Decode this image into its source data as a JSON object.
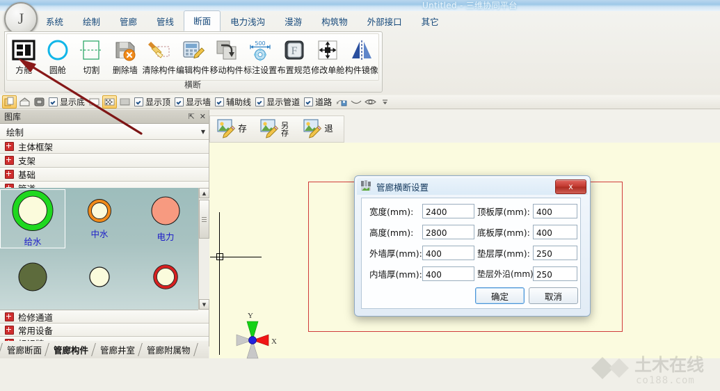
{
  "window": {
    "title": "Untitled - 三维协同平台",
    "app_badge": "J"
  },
  "ribbon": {
    "tabs": [
      {
        "label": "系统",
        "active": false
      },
      {
        "label": "绘制",
        "active": false
      },
      {
        "label": "管廊",
        "active": false
      },
      {
        "label": "管线",
        "active": false
      },
      {
        "label": "断面",
        "active": true
      },
      {
        "label": "电力浅沟",
        "active": false
      },
      {
        "label": "漫游",
        "active": false
      },
      {
        "label": "构筑物",
        "active": false
      },
      {
        "label": "外部接口",
        "active": false
      },
      {
        "label": "其它",
        "active": false
      }
    ],
    "group_label": "横断",
    "buttons": [
      {
        "label": "方舱",
        "icon": "box-cabin-icon"
      },
      {
        "label": "圆舱",
        "icon": "circle-cabin-icon"
      },
      {
        "label": "切割",
        "icon": "cut-icon"
      },
      {
        "label": "删除墙",
        "icon": "delete-wall-icon"
      },
      {
        "label": "清除构件",
        "icon": "clear-component-icon"
      },
      {
        "label": "编辑构件",
        "icon": "edit-component-icon"
      },
      {
        "label": "移动构件",
        "icon": "move-component-icon"
      },
      {
        "label": "标注设置",
        "icon": "dimension-settings-icon"
      },
      {
        "label": "布置规范",
        "icon": "layout-spec-icon"
      },
      {
        "label": "修改单舱",
        "icon": "modify-cabin-icon"
      },
      {
        "label": "构件镜像",
        "icon": "mirror-component-icon"
      }
    ]
  },
  "viewbar": {
    "icons": [
      "copy-layer-icon",
      "house-icon",
      "solid-view-icon"
    ],
    "icons2": [
      "blank-fill-icon",
      "checker-fill-icon",
      "hatch-fill-icon"
    ],
    "icons3": [
      "save-view-icon",
      "curve-icon",
      "eye-icon",
      "more-icon"
    ],
    "checks": [
      {
        "label": "显示底",
        "checked": true
      },
      {
        "label": "显示顶",
        "checked": true
      },
      {
        "label": "显示墙",
        "checked": true
      },
      {
        "label": "辅助线",
        "checked": true
      },
      {
        "label": "显示管道",
        "checked": true
      },
      {
        "label": "道路",
        "checked": true
      }
    ]
  },
  "library": {
    "title": "图库",
    "pin_icon": "pin-icon",
    "close_icon": "close-icon",
    "category": "绘制",
    "items_top": [
      {
        "label": "主体框架"
      },
      {
        "label": "支架"
      },
      {
        "label": "基础"
      },
      {
        "label": "管道"
      }
    ],
    "thumbnails": [
      {
        "label": "给水",
        "style": "ring",
        "ring": "#1fd81f",
        "fill": "#fbfbdc",
        "selected": true
      },
      {
        "label": "中水",
        "style": "ring",
        "ring": "#f08a1a",
        "fill": "#fbfbdc",
        "selected": false
      },
      {
        "label": "电力",
        "style": "solid",
        "ring": "#1a1a1a",
        "fill": "#f79a80",
        "selected": false
      },
      {
        "label": "",
        "style": "solid",
        "ring": "#1a1a1a",
        "fill": "#5d6b3c",
        "selected": false
      },
      {
        "label": "",
        "style": "ring",
        "ring": "#1a1a1a",
        "fill": "#fbfbdc",
        "selected": false
      },
      {
        "label": "",
        "style": "ring",
        "ring": "#d81f1f",
        "fill": "#fbfbdc",
        "selected": false
      }
    ],
    "items_bottom": [
      {
        "label": "检修通道"
      },
      {
        "label": "常用设备"
      },
      {
        "label": "标识牌"
      }
    ],
    "bottom_tabs": [
      {
        "label": "管廊断面",
        "active": false
      },
      {
        "label": "管廊构件",
        "active": true
      },
      {
        "label": "管廊井室",
        "active": false
      },
      {
        "label": "管廊附属物",
        "active": false
      }
    ]
  },
  "canvas": {
    "save_buttons": [
      {
        "label": "存",
        "icon": "save-image-icon"
      },
      {
        "label": "另存",
        "icon": "save-as-image-icon"
      },
      {
        "label": "退",
        "icon": "exit-image-icon"
      }
    ],
    "axis": {
      "x": "X",
      "y": "Y"
    },
    "watermark": {
      "text": "土木在线",
      "sub": "co188.com"
    }
  },
  "dialog": {
    "title": "管廊横断设置",
    "icon": "dialog-icon",
    "close_label": "x",
    "fields_left": [
      {
        "label": "宽度(mm):",
        "value": "2400",
        "name": "width-field"
      },
      {
        "label": "高度(mm):",
        "value": "2800",
        "name": "height-field"
      },
      {
        "label": "外墙厚(mm):",
        "value": "400",
        "name": "outer-wall-thickness-field"
      },
      {
        "label": "内墙厚(mm):",
        "value": "400",
        "name": "inner-wall-thickness-field"
      }
    ],
    "fields_right": [
      {
        "label": "顶板厚(mm):",
        "value": "400",
        "name": "top-slab-thickness-field"
      },
      {
        "label": "底板厚(mm):",
        "value": "400",
        "name": "bottom-slab-thickness-field"
      },
      {
        "label": "垫层厚(mm):",
        "value": "250",
        "name": "cushion-thickness-field"
      },
      {
        "label": "垫层外沿(mm):",
        "value": "250",
        "name": "cushion-edge-field"
      }
    ],
    "ok_label": "确定",
    "cancel_label": "取消"
  },
  "colors": {
    "title_accent": "#9ec8e8",
    "tab_text": "#15487a",
    "canvas_bg": "#fbfbdf",
    "red_rect": "#d03a3a",
    "annotation_arrow": "#8b1a1a"
  }
}
